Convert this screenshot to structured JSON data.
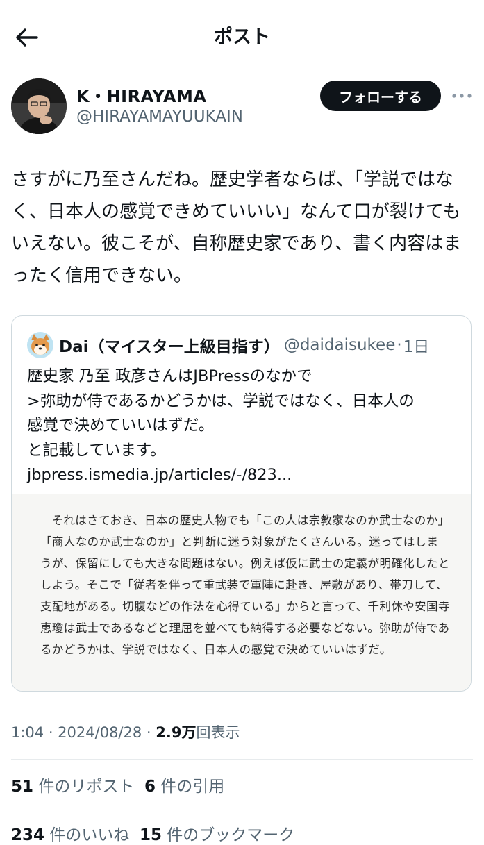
{
  "header": {
    "title": "ポスト"
  },
  "author": {
    "display_name": "K・HIRAYAMA",
    "handle": "@HIRAYAMAYUUKAIN",
    "follow_label": "フォローする"
  },
  "post": {
    "text": "さすがに乃至さんだね。歴史学者ならば、「学説ではなく、日本人の感覚できめていいい」なんて口が裂けてもいえない。彼こそが、自称歴史家であり、書く内容はまったく信用できない。",
    "timestamp": "1:04 · 2024/08/28 · ",
    "views_count": "2.9万",
    "views_label": "回表示"
  },
  "quote": {
    "name": "Dai（マイスター上級目指す）",
    "handle": "@daidaisukee",
    "separator": "·",
    "time": "1日",
    "text_lines": [
      "歴史家 乃至 政彦さんはJBPressのなかで",
      ">弥助が侍であるかどうかは、学説ではなく、日本人の",
      "感覚で決めていいはずだ。",
      "と記載しています。",
      "jbpress.ismedia.jp/articles/-/823..."
    ],
    "excerpt": "それはさておき、日本の歴史人物でも「この人は宗教家なのか武士なのか」「商人なのか武士なのか」と判断に迷う対象がたくさんいる。迷ってはしまうが、保留にしても大きな問題はない。例えば仮に武士の定義が明確化したとしよう。そこで「従者を伴って重武装で軍陣に赴き、屋敷があり、帯刀して、支配地がある。切腹などの作法を心得ている」からと言って、千利休や安国寺恵瓊は武士であるなどと理屈を並べても納得する必要などない。弥助が侍であるかどうかは、学説ではなく、日本人の感覚で決めていいはずだ。"
  },
  "stats": {
    "reposts_count": "51",
    "reposts_label": "件のリポスト",
    "quotes_count": "6",
    "quotes_label": "件の引用",
    "likes_count": "234",
    "likes_label": "件のいいね",
    "bookmarks_count": "15",
    "bookmarks_label": "件のブックマーク"
  },
  "icons": {
    "back": "arrow-left-icon",
    "more": "more-horizontal-icon"
  },
  "colors": {
    "text": "#0f1419",
    "secondary": "#536471",
    "button_bg": "#0f1419",
    "border": "#cfd9de"
  }
}
